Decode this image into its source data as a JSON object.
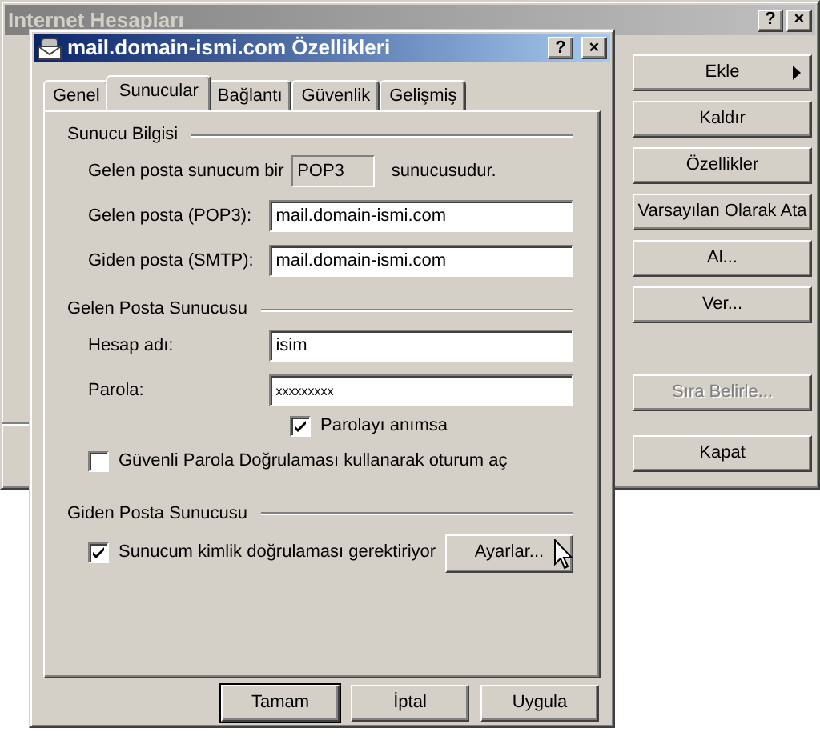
{
  "background_window": {
    "title": "Internet Hesapları",
    "title_buttons": [
      "?",
      "×"
    ],
    "buttons": [
      {
        "label": "Ekle",
        "kind": "menu",
        "disabled": false
      },
      {
        "label": "Kaldır",
        "kind": "push",
        "disabled": false
      },
      {
        "label": "Özellikler",
        "kind": "push",
        "disabled": false
      },
      {
        "label": "Varsayılan Olarak Ata",
        "kind": "push",
        "disabled": false
      },
      {
        "label": "Al...",
        "kind": "push",
        "disabled": false
      },
      {
        "label": "Ver...",
        "kind": "push",
        "disabled": false
      },
      {
        "label": "Sıra Belirle...",
        "kind": "push",
        "disabled": true
      }
    ],
    "close_button": "Kapat"
  },
  "dialog": {
    "title": "mail.domain-ismi.com Özellikleri",
    "title_buttons": [
      "?",
      "×"
    ],
    "tabs": [
      {
        "label": "Genel",
        "selected": false
      },
      {
        "label": "Sunucular",
        "selected": true
      },
      {
        "label": "Bağlantı",
        "selected": false
      },
      {
        "label": "Güvenlik",
        "selected": false
      },
      {
        "label": "Gelişmiş",
        "selected": false
      }
    ],
    "server_info": {
      "heading": "Sunucu Bilgisi",
      "type_prefix": "Gelen posta sunucum bir",
      "type_value": "POP3",
      "type_suffix": "sunucusudur.",
      "fields": [
        {
          "label": "Gelen posta (POP3):",
          "value": "mail.domain-ismi.com"
        },
        {
          "label": "Giden posta (SMTP):",
          "value": "mail.domain-ismi.com"
        }
      ]
    },
    "incoming": {
      "heading": "Gelen Posta Sunucusu",
      "fields": [
        {
          "label": "Hesap adı:",
          "value": "isim",
          "masked": false
        },
        {
          "label": "Parola:",
          "value": "xxxxxxxxx",
          "masked": true
        }
      ],
      "remember_password": {
        "label": "Parolayı anımsa",
        "checked": true
      },
      "secure_auth": {
        "label": "Güvenli Parola Doğrulaması kullanarak oturum aç",
        "checked": false
      }
    },
    "outgoing": {
      "heading": "Giden Posta Sunucusu",
      "auth": {
        "label": "Sunucum kimlik doğrulaması gerektiriyor",
        "checked": true
      },
      "settings_button": "Ayarlar..."
    },
    "footer_buttons": [
      {
        "label": "Tamam",
        "default": true
      },
      {
        "label": "İptal",
        "default": false
      },
      {
        "label": "Uygula",
        "default": false
      }
    ]
  }
}
